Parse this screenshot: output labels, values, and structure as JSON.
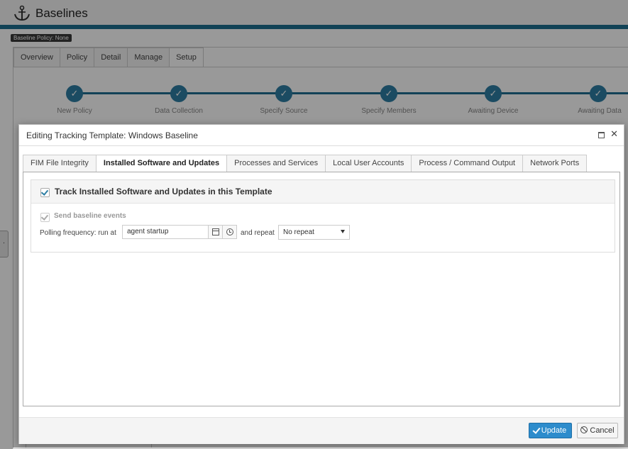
{
  "app": {
    "title": "Baselines",
    "policy_badge": "Baseline Policy: None",
    "tabs": [
      "Overview",
      "Policy",
      "Detail",
      "Manage",
      "Setup"
    ],
    "active_tab": "Setup",
    "wizard_steps": [
      "New Policy",
      "Data Collection",
      "Specify Source",
      "Specify Members",
      "Awaiting Device",
      "Awaiting Data"
    ],
    "side_handle": "·",
    "accent_color": "#1d6f8f"
  },
  "modal": {
    "title": "Editing Tracking Template: Windows Baseline",
    "close_symbol": "✕",
    "tabs": [
      "FIM File Integrity",
      "Installed Software and Updates",
      "Processes and Services",
      "Local User Accounts",
      "Process / Command Output",
      "Network Ports"
    ],
    "active_tab": "Installed Software and Updates",
    "section": {
      "title": "Track Installed Software and Updates in this Template",
      "tracking_checked": true,
      "send_events_label": "Send baseline events",
      "send_events_checked": true,
      "polling_label": "Polling frequency: run at",
      "run_at_value": "agent startup",
      "repeat_label": "and repeat",
      "repeat_value": "No repeat"
    },
    "footer": {
      "update_label": "Update",
      "cancel_label": "Cancel",
      "update_color": "#2d8ccc"
    }
  }
}
